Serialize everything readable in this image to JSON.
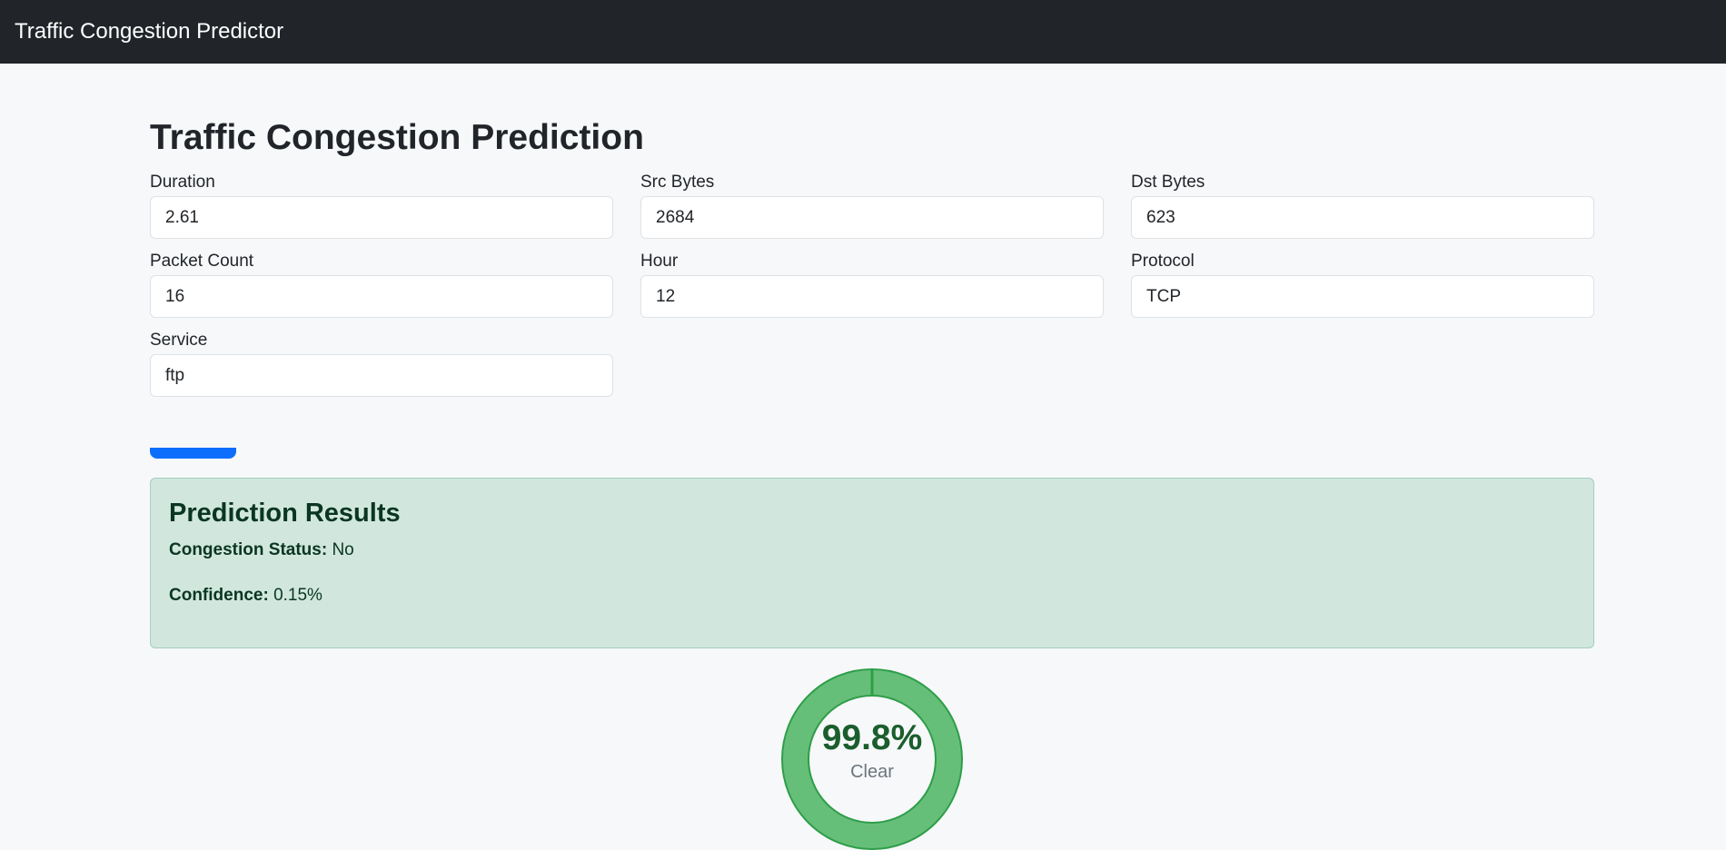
{
  "navbar": {
    "brand": "Traffic Congestion Predictor"
  },
  "page": {
    "title": "Traffic Congestion Prediction"
  },
  "form": {
    "duration": {
      "label": "Duration",
      "value": "2.61"
    },
    "src_bytes": {
      "label": "Src Bytes",
      "value": "2684"
    },
    "dst_bytes": {
      "label": "Dst Bytes",
      "value": "623"
    },
    "packet_count": {
      "label": "Packet Count",
      "value": "16"
    },
    "hour": {
      "label": "Hour",
      "value": "12"
    },
    "protocol": {
      "label": "Protocol",
      "value": "TCP"
    },
    "service": {
      "label": "Service",
      "value": "ftp"
    }
  },
  "results": {
    "title": "Prediction Results",
    "status_label": "Congestion Status:",
    "status_value": "No",
    "confidence_label": "Confidence:",
    "confidence_value": "0.15%"
  },
  "gauge": {
    "value_text": "99.8%",
    "label": "Clear",
    "level": 0.998,
    "fill_color": "#66bf78",
    "stroke_color": "#2e9e49"
  },
  "colors": {
    "navbar_bg": "#212529",
    "primary": "#0d6efd",
    "success_bg": "#d1e7dd",
    "success_text": "#0a3622"
  }
}
